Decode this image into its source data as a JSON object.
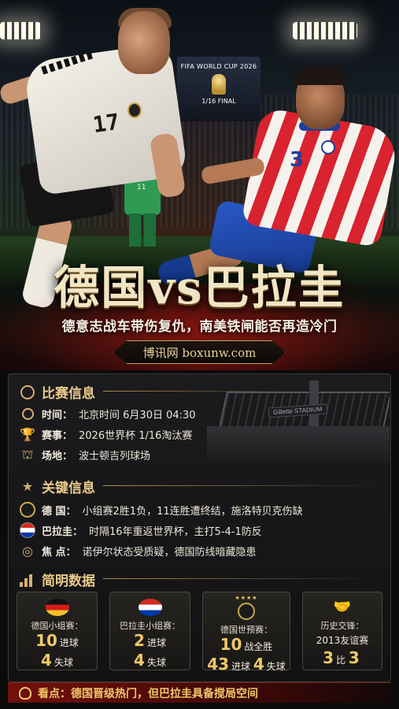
{
  "hero": {
    "scoreboard_title": "FIFA WORLD CUP 2026",
    "scoreboard_round": "1/16 FINAL",
    "germany_shirt_number": "17",
    "paraguay_shirt_number": "3",
    "goalkeeper_number": "11",
    "stadium_sign": "Gillette STADIUM",
    "headline_left": "德国",
    "headline_vs": "vs",
    "headline_right": "巴拉圭",
    "subtitle": "德意志战车带伤复仇，南美铁闸能否再造冷门",
    "brand": "博讯网  boxunw.com"
  },
  "match_info": {
    "title": "比赛信息",
    "time_label": "时间：",
    "time_value": "北京时间 6月30日 04:30",
    "event_label": "赛事：",
    "event_value": "2026世界杯 1/16淘汰赛",
    "venue_label": "场地：",
    "venue_value": "波士顿吉列球场"
  },
  "key_info": {
    "title": "关键信息",
    "germany_label": "德  国：",
    "germany_value": "小组赛2胜1负，11连胜遭终结，施洛特贝克伤缺",
    "paraguay_label": "巴拉圭：",
    "paraguay_value": "时隔16年重返世界杯，主打5-4-1防反",
    "focus_label": "焦  点：",
    "focus_value": "诺伊尔状态受质疑，德国防线暗藏隐患"
  },
  "stats": {
    "title": "简明数据",
    "cards": [
      {
        "title": "德国小组赛：",
        "line1_num": "10",
        "line1_text": "进球",
        "line2_num": "4",
        "line2_text": "失球"
      },
      {
        "title": "巴拉圭小组赛：",
        "line1_num": "2",
        "line1_text": "进球",
        "line2_num": "4",
        "line2_text": "失球"
      },
      {
        "title": "德国世预赛：",
        "line1_num": "10",
        "line1_text": "战全胜",
        "line2_num": "43",
        "line2_text": "进球",
        "line2_num_b": "4",
        "line2_text_b": "失球"
      },
      {
        "title": "历史交锋：",
        "line1_text": "2013友谊赛",
        "line2_num": "3",
        "line2_text": "比",
        "line2_num_b": "3"
      }
    ]
  },
  "footer": {
    "text": "看点：德国晋级热门，但巴拉圭具备搅局空间"
  },
  "colors": {
    "gold": "#f0c86a",
    "section_title": "#e9c98a",
    "footer_bg": "#78100c"
  },
  "icons": {
    "time": "clock-icon",
    "event": "trophy-icon",
    "venue": "stadium-icon",
    "key": "star-icon",
    "stats": "bar-chart-icon",
    "footer": "lightbulb-icon",
    "history": "handshake-icon"
  }
}
